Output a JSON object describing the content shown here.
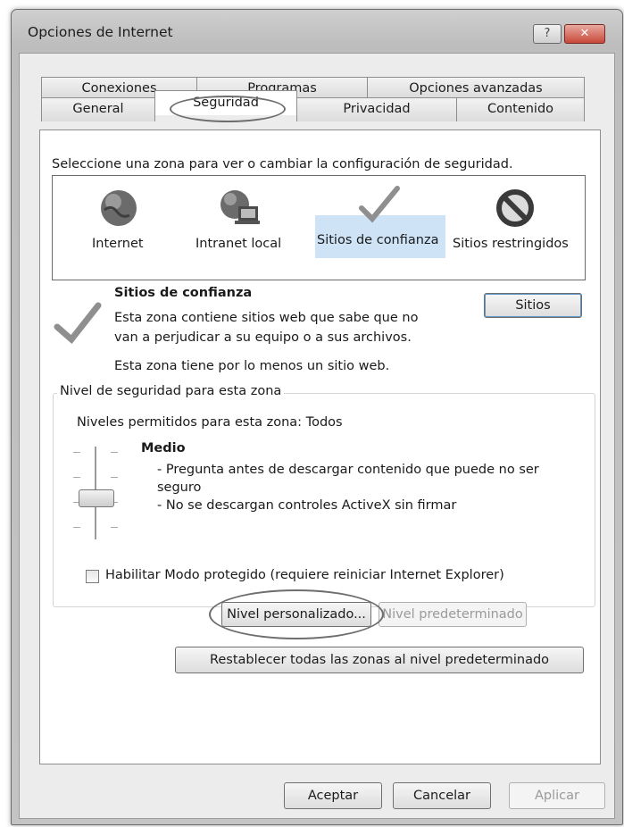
{
  "window": {
    "title": "Opciones de Internet",
    "help_label": "?",
    "close_label": "✕"
  },
  "tabs": {
    "row1": [
      "Conexiones",
      "Programas",
      "Opciones avanzadas"
    ],
    "row2": [
      "General",
      "Seguridad",
      "Privacidad",
      "Contenido"
    ],
    "active": "Seguridad"
  },
  "security": {
    "zones_prompt": "Seleccione una zona para ver o cambiar la configuración de seguridad.",
    "zones": [
      {
        "label": "Internet",
        "icon": "globe-icon"
      },
      {
        "label": "Intranet local",
        "icon": "intranet-icon"
      },
      {
        "label": "Sitios de confianza",
        "icon": "checkmark-icon"
      },
      {
        "label": "Sitios restringidos",
        "icon": "prohibited-icon"
      }
    ],
    "selected_zone": "Sitios de confianza",
    "zone_title": "Sitios de confianza",
    "zone_desc_1": "Esta zona contiene sitios web que sabe que no",
    "zone_desc_2": "van a perjudicar a su equipo o a sus archivos.",
    "zone_note": "Esta zona tiene por lo menos un sitio web.",
    "sites_button": "Sitios",
    "level_group_title": "Nivel de seguridad para esta zona",
    "allowed_levels": "Niveles permitidos para esta zona: Todos",
    "level_name": "Medio",
    "level_desc_1": "- Pregunta antes de descargar contenido que puede no ser",
    "level_desc_2": "seguro",
    "level_desc_3": "- No se descargan controles ActiveX sin firmar",
    "protected_mode_label": "Habilitar Modo protegido (requiere reiniciar Internet Explorer)",
    "protected_mode_checked": false,
    "custom_level_button": "Nivel personalizado...",
    "default_level_button": "Nivel predeterminado",
    "reset_all_button": "Restablecer todas las zonas al nivel predeterminado"
  },
  "footer": {
    "ok": "Aceptar",
    "cancel": "Cancelar",
    "apply": "Aplicar"
  },
  "colors": {
    "highlight": "#cfe3f7",
    "annotation_ring": "#6e6e6e"
  }
}
